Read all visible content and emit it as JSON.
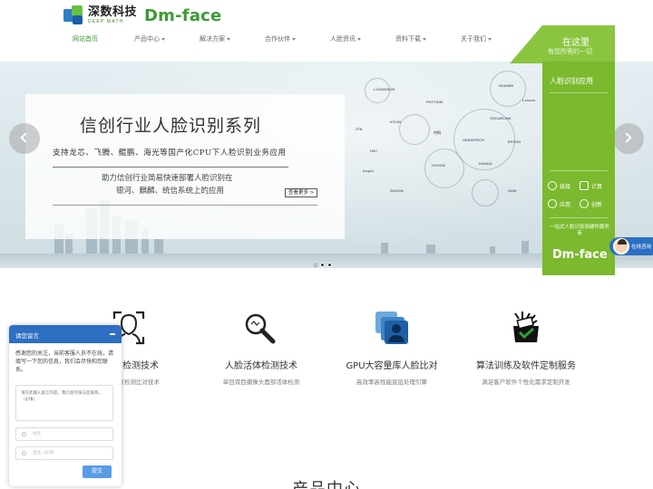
{
  "header": {
    "logo_cn": "深数科技",
    "logo_tagline": "DEEP MATH",
    "logo_en": "Dm-face"
  },
  "nav": {
    "items": [
      {
        "label": "网站首页",
        "active": true,
        "dropdown": false
      },
      {
        "label": "产品中心",
        "active": false,
        "dropdown": true
      },
      {
        "label": "解决方案",
        "active": false,
        "dropdown": true
      },
      {
        "label": "合作伙伴",
        "active": false,
        "dropdown": true
      },
      {
        "label": "人脸资讯",
        "active": false,
        "dropdown": true
      },
      {
        "label": "资料下载",
        "active": false,
        "dropdown": true
      },
      {
        "label": "关于我们",
        "active": false,
        "dropdown": true
      }
    ]
  },
  "banner": {
    "title": "信创行业人脸识别系列",
    "subtitle": "支持龙芯、飞腾、鲲鹏、海光等国产化CPU下人脸识别业务应用",
    "desc_line1": "助力信创行业简易快速部署人脸识别在",
    "desc_line2": "银河、麒麟、统信系统上的应用",
    "more_label": "查看更多 >",
    "slide_count": 3,
    "active_slide": 1
  },
  "side_panel": {
    "title": "在这里",
    "subtitle": "有您所需的一切",
    "heading": "人脸识别应用",
    "features": [
      {
        "icon": "share-icon",
        "label": "链接"
      },
      {
        "icon": "grid-icon",
        "label": "计算"
      },
      {
        "icon": "app-icon",
        "label": "应用"
      },
      {
        "icon": "innovation-icon",
        "label": "创新"
      }
    ],
    "tagline": "一站式人脸识别软硬件服务商",
    "logo": "Dm-face",
    "online_cs": "在线咨询"
  },
  "services": [
    {
      "name": "…检测技术",
      "desc": "…点检测比对技术",
      "icon": "face-scan-icon"
    },
    {
      "name": "人脸活体检测技术",
      "desc": "单目双目摄像头面部活体检测",
      "icon": "magnifier-icon"
    },
    {
      "name": "GPU大容量库人脸比对",
      "desc": "高效率高性能底层处理引擎",
      "icon": "gpu-users-icon"
    },
    {
      "name": "算法训练及软件定制服务",
      "desc": "满足客户软件个性化需求定制开发",
      "icon": "training-icon"
    }
  ],
  "section": {
    "title": "产品中心"
  },
  "message_widget": {
    "title": "请您留言",
    "intro": "感谢您的关注，当前客服人员不在线，请填写一下您的信息，我们会尽快和您联系。",
    "content_placeholder": "请在此输入留言内容，我们会尽快与您联系。（必填）",
    "name_placeholder": "姓名",
    "phone_placeholder": "电话（必填）",
    "submit_label": "提交"
  },
  "colors": {
    "brand_green": "#3c9b34",
    "panel_green": "#7bb92e",
    "widget_blue": "#2d6fc2"
  }
}
